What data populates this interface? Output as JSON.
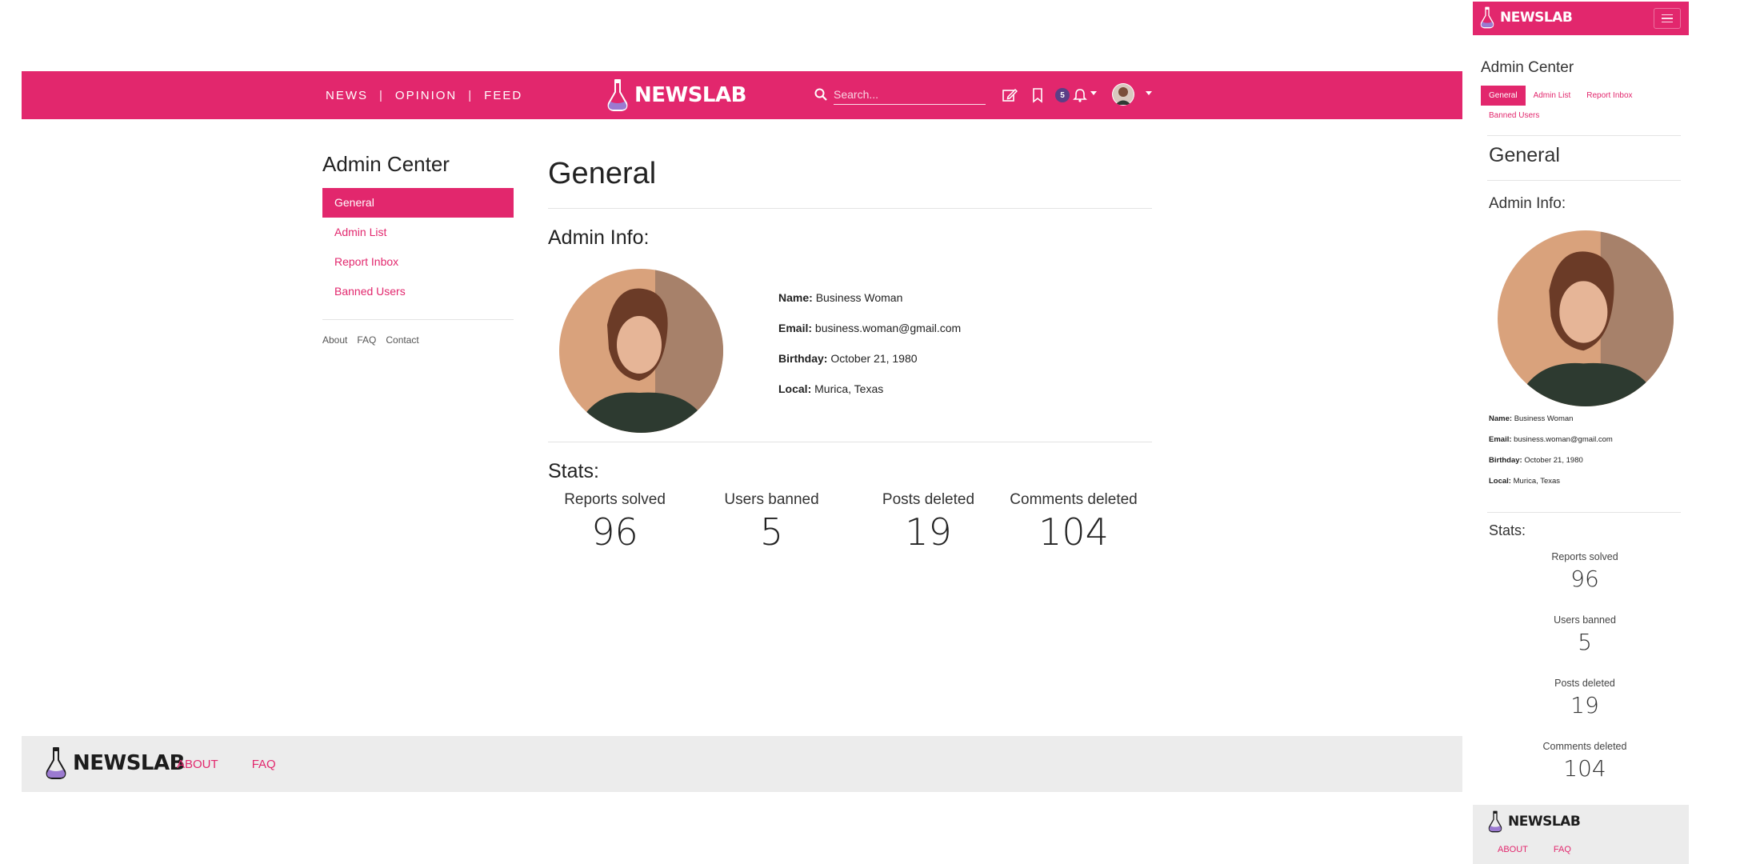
{
  "colors": {
    "brand": "#e2276d",
    "badge": "#5b3f86",
    "footer_bg": "#ececec"
  },
  "nav": {
    "links": [
      "NEWS",
      "OPINION",
      "FEED"
    ],
    "separator": "|",
    "brand": "NEWSLAB",
    "search_placeholder": "Search...",
    "notification_count": "5"
  },
  "sidebar": {
    "title": "Admin Center",
    "items": [
      "General",
      "Admin List",
      "Report Inbox",
      "Banned Users"
    ],
    "active": "General",
    "footer_links": [
      "About",
      "FAQ",
      "Contact"
    ]
  },
  "main": {
    "title": "General",
    "admin_info_title": "Admin Info:",
    "fields": {
      "name_label": "Name:",
      "name": "Business Woman",
      "email_label": "Email:",
      "email": "business.woman@gmail.com",
      "birthday_label": "Birthday:",
      "birthday": "October 21, 1980",
      "local_label": "Local:",
      "local": "Murica, Texas"
    },
    "stats_title": "Stats:",
    "stats": [
      {
        "label": "Reports solved",
        "value": "96"
      },
      {
        "label": "Users banned",
        "value": "5"
      },
      {
        "label": "Posts deleted",
        "value": "19"
      },
      {
        "label": "Comments deleted",
        "value": "104"
      }
    ]
  },
  "footer": {
    "brand": "NEWSLAB",
    "links": [
      "ABOUT",
      "FAQ"
    ]
  }
}
